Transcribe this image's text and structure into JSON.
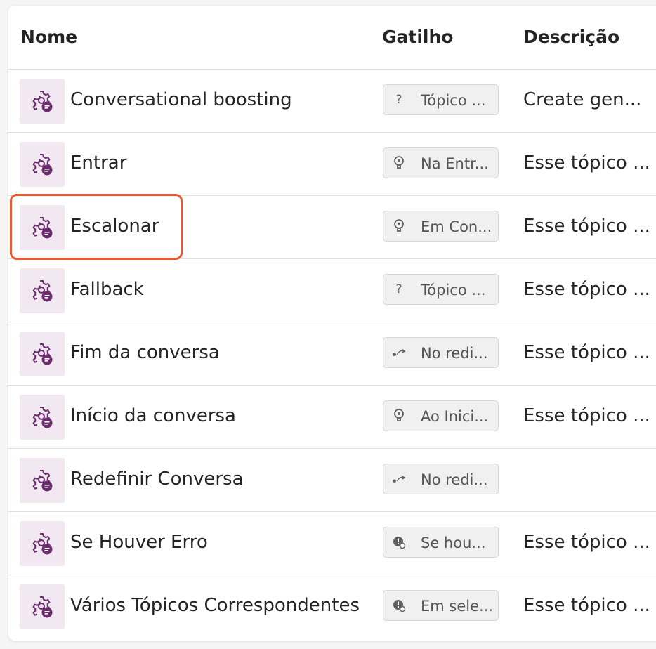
{
  "table": {
    "headers": {
      "name": "Nome",
      "trigger": "Gatilho",
      "description": "Descrição"
    },
    "rows": [
      {
        "name": "Conversational boosting",
        "trigger": "Tópico ...",
        "trigger_icon": "question-icon",
        "description": "Create gen..."
      },
      {
        "name": "Entrar",
        "trigger": "Na Entr...",
        "trigger_icon": "lightbulb-icon",
        "description": "Esse tópico ..."
      },
      {
        "name": "Escalonar",
        "trigger": "Em Con...",
        "trigger_icon": "lightbulb-icon",
        "description": "Esse tópico ..."
      },
      {
        "name": "Fallback",
        "trigger": "Tópico ...",
        "trigger_icon": "question-icon",
        "description": "Esse tópico ..."
      },
      {
        "name": "Fim da conversa",
        "trigger": "No redi...",
        "trigger_icon": "redirect-icon",
        "description": "Esse tópico ..."
      },
      {
        "name": "Início da conversa",
        "trigger": "Ao Inici...",
        "trigger_icon": "lightbulb-icon",
        "description": "Esse tópico ..."
      },
      {
        "name": "Redefinir Conversa",
        "trigger": "No redi...",
        "trigger_icon": "redirect-icon",
        "description": ""
      },
      {
        "name": "Se Houver Erro",
        "trigger": "Se hou...",
        "trigger_icon": "error-gear-icon",
        "description": "Esse tópico ..."
      },
      {
        "name": "Vários Tópicos Correspondentes",
        "trigger": "Em sele...",
        "trigger_icon": "error-gear-icon",
        "description": "Esse tópico ..."
      }
    ],
    "highlighted_row": "Escalonar"
  },
  "colors": {
    "icon_bg": "#f1e8f1",
    "icon_accent": "#6b2c6e",
    "highlight": "#e8572e"
  }
}
